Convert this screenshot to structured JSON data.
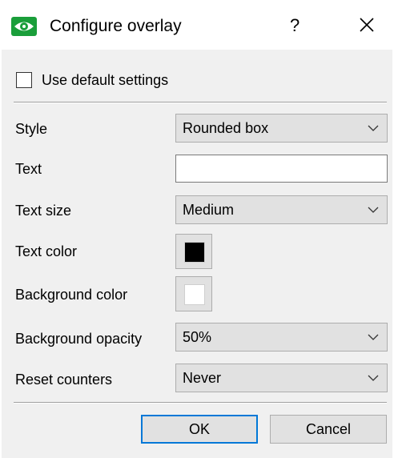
{
  "window": {
    "title": "Configure overlay",
    "help_label": "?",
    "icon": "eye-icon",
    "accent_color": "#1a9e3a"
  },
  "use_default": {
    "label": "Use default settings",
    "checked": false
  },
  "fields": {
    "style": {
      "label": "Style",
      "value": "Rounded box"
    },
    "text": {
      "label": "Text",
      "value": ""
    },
    "text_size": {
      "label": "Text size",
      "value": "Medium"
    },
    "text_color": {
      "label": "Text color",
      "color": "#000000"
    },
    "background_color": {
      "label": "Background color",
      "color": "#ffffff"
    },
    "background_opacity": {
      "label": "Background opacity",
      "value": "50%"
    },
    "reset_counters": {
      "label": "Reset counters",
      "value": "Never"
    }
  },
  "buttons": {
    "ok": "OK",
    "cancel": "Cancel"
  }
}
